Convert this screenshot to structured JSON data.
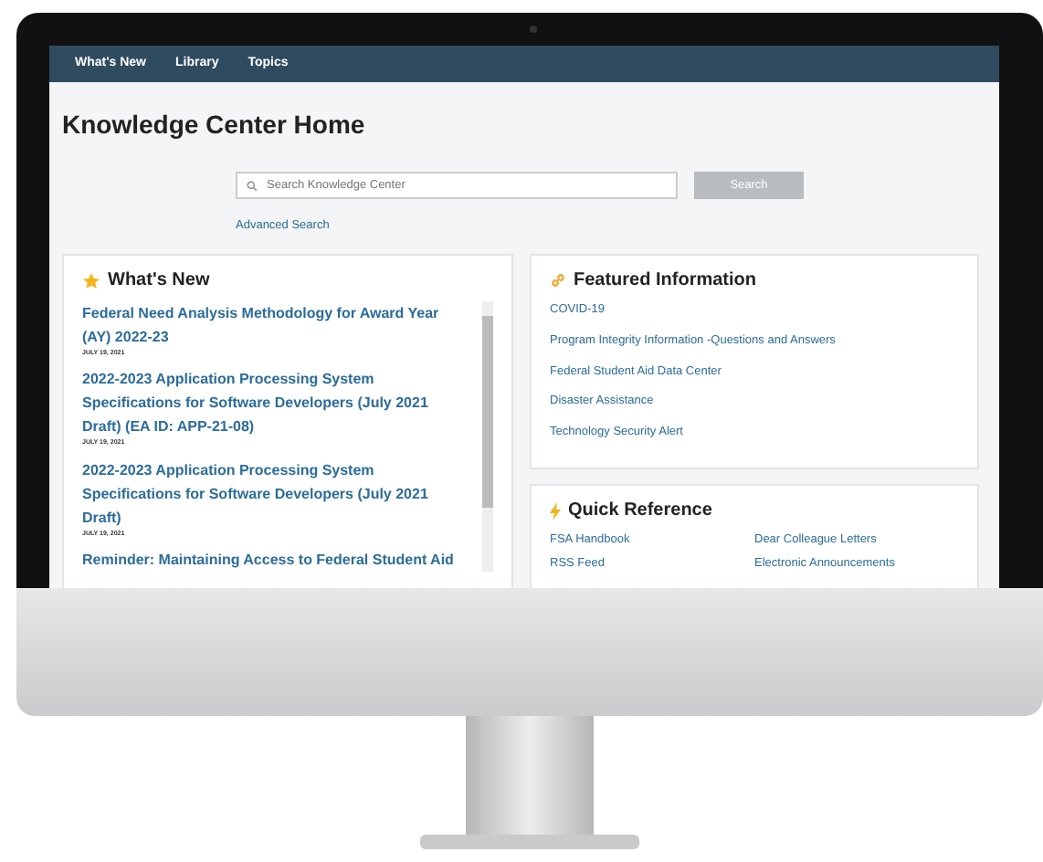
{
  "nav": [
    {
      "label": "What's New"
    },
    {
      "label": "Library"
    },
    {
      "label": "Topics"
    }
  ],
  "page_title": "Knowledge Center Home",
  "search": {
    "placeholder": "Search Knowledge Center",
    "button": "Search",
    "advanced_link": "Advanced Search"
  },
  "whats_new": {
    "title": "What's New",
    "items": [
      {
        "title": "Federal Need Analysis Methodology for Award Year (AY) 2022-23",
        "date": "JULY 19, 2021"
      },
      {
        "title": "2022-2023 Application Processing System Specifications for Software Developers (July 2021 Draft) (EA ID: APP-21-08)",
        "date": "JULY 19, 2021"
      },
      {
        "title": "2022-2023 Application Processing System Specifications for Software Developers (July 2021 Draft)",
        "date": "JULY 19, 2021"
      },
      {
        "title": "Reminder: Maintaining Access to Federal Student Aid"
      }
    ]
  },
  "featured": {
    "title": "Featured Information",
    "links": [
      "COVID-19",
      "Program Integrity Information -Questions and Answers",
      "Federal Student Aid Data Center",
      "Disaster Assistance",
      "Technology Security Alert"
    ]
  },
  "quick_reference": {
    "title": "Quick Reference",
    "links": [
      "FSA Handbook",
      "Dear Colleague Letters",
      "RSS Feed",
      "Electronic Announcements"
    ]
  }
}
